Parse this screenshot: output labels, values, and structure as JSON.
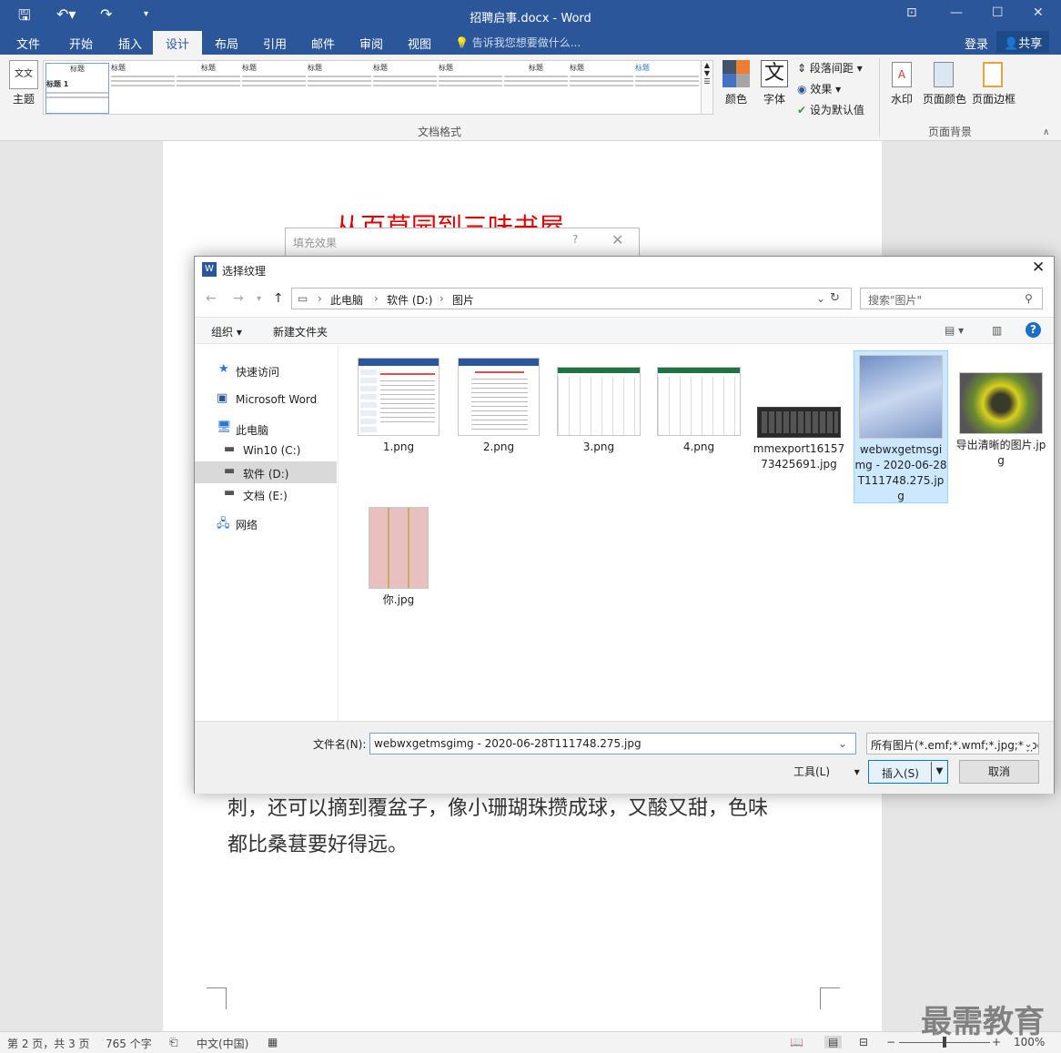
{
  "window": {
    "title": "招聘启事.docx - Word",
    "quick_access": [
      "save-icon",
      "undo-icon",
      "redo-icon",
      "customize-icon"
    ]
  },
  "tabs": [
    "文件",
    "开始",
    "插入",
    "设计",
    "布局",
    "引用",
    "邮件",
    "审阅",
    "视图"
  ],
  "active_tab": "设计",
  "tellme": "告诉我您想要做什么...",
  "account": {
    "login": "登录",
    "share": "共享"
  },
  "ribbon": {
    "theme_label": "主题",
    "gallery_items": [
      "标题",
      "标题",
      "标题",
      "标题",
      "标题",
      "标题",
      "标题",
      "标题",
      "标题",
      "标题"
    ],
    "first_heading": "标题 1",
    "colors_label": "颜色",
    "fonts_label": "字体",
    "paragraph_spacing": "段落间距",
    "effects": "效果",
    "set_default": "设为默认值",
    "group_document_format": "文档格式",
    "watermark_label": "水印",
    "page_color_label": "页面颜色",
    "page_border_label": "页面边框",
    "group_page_background": "页面背景"
  },
  "document": {
    "title": "从百草园到三味书屋",
    "line1": "刺，还可以摘到覆盆子，像小珊瑚珠攒成球，又酸又甜，色味",
    "line2": "都比桑葚要好得远。"
  },
  "fill_dialog": {
    "title": "填充效果",
    "help": "?"
  },
  "dialog": {
    "title": "选择纹理",
    "address": [
      "此电脑",
      "软件 (D:)",
      "图片"
    ],
    "search_placeholder": "搜索\"图片\"",
    "organize": "组织",
    "new_folder": "新建文件夹",
    "nav": [
      "快速访问",
      "Microsoft Word",
      "此电脑",
      "Win10 (C:)",
      "软件 (D:)",
      "文档 (E:)",
      "网络"
    ],
    "files": [
      "1.png",
      "2.png",
      "3.png",
      "4.png",
      "mmexport1615773425691.jpg",
      "webwxgetmsgimg - 2020-06-28T111748.275.jpg",
      "导出清晰的图片.jpg",
      "你.jpg"
    ],
    "filename_label": "文件名(N):",
    "filename_value": "webwxgetmsgimg - 2020-06-28T111748.275.jpg",
    "filetype": "所有图片(*.emf;*.wmf;*.jpg;*.jpeg",
    "tools": "工具(L)",
    "insert": "插入(S)",
    "cancel": "取消"
  },
  "status": {
    "page": "第 2 页，共 3 页",
    "words": "765 个字",
    "language": "中文(中国)",
    "zoom": "100%",
    "zoom_level": 0.5
  },
  "brand_watermark": "最需教育",
  "colors": {
    "word_blue": "#2b579a",
    "selection": "#cce8ff",
    "title_red": "#e00000"
  }
}
